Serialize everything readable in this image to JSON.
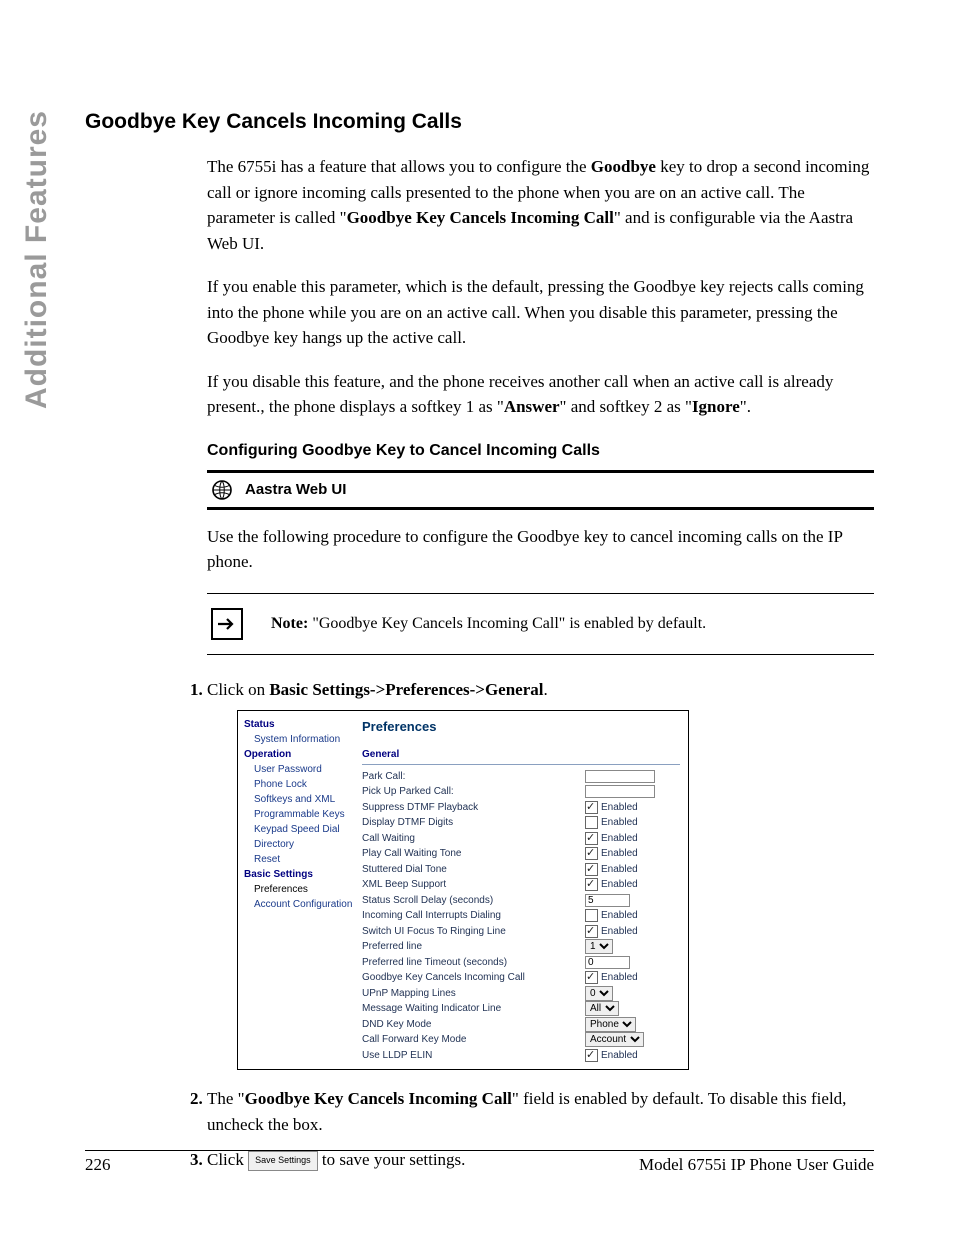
{
  "sideTab": "Additional Features",
  "title": "Goodbye Key Cancels Incoming Calls",
  "para1_a": "The 6755i has a feature that allows you to configure the ",
  "para1_b": "Goodbye",
  "para1_c": " key to drop a second incoming call or ignore incoming calls presented to the phone when you are on an active call. The parameter is called \"",
  "para1_d": "Goodbye Key Cancels Incoming Call",
  "para1_e": "\" and is configurable via the Aastra Web UI.",
  "para2": "If you enable this parameter, which is the default, pressing the Goodbye key rejects calls coming into the phone while you are on an active call. When you disable this parameter, pressing the Goodbye key hangs up the active call.",
  "para3_a": "If you disable this feature, and the phone receives another call when an active call is already present., the phone displays a softkey 1 as \"",
  "para3_b": "Answer",
  "para3_c": "\" and softkey 2 as \"",
  "para3_d": "Ignore",
  "para3_e": "\".",
  "subTitle": "Configuring Goodbye Key to Cancel Incoming Calls",
  "webUiLabel": "Aastra Web UI",
  "para4": "Use the following procedure to configure the Goodbye key to cancel incoming calls on the IP phone.",
  "note_a": "Note:",
  "note_b": " \"Goodbye Key Cancels Incoming Call\" is enabled by default.",
  "step1_a": "Click on ",
  "step1_b": "Basic Settings->Preferences->General",
  "step1_c": ".",
  "step2_a": "The \"",
  "step2_b": "Goodbye Key Cancels Incoming Call",
  "step2_c": "\" field is enabled by default. To disable this field, uncheck the box.",
  "step3_a": "Click ",
  "step3_btn": "Save Settings",
  "step3_b": " to save your settings.",
  "footerPage": "226",
  "footerTitle": "Model 6755i IP Phone User Guide",
  "ui": {
    "nav": {
      "h1": "Status",
      "i1": "System Information",
      "h2": "Operation",
      "i2": "User Password",
      "i3": "Phone Lock",
      "i4": "Softkeys and XML",
      "i5": "Programmable Keys",
      "i6": "Keypad Speed Dial",
      "i7": "Directory",
      "i8": "Reset",
      "h3": "Basic Settings",
      "i9": "Preferences",
      "i10": "Account Configuration"
    },
    "mainTitle": "Preferences",
    "secHdr": "General",
    "rows": {
      "r1": "Park Call:",
      "r2": "Pick Up Parked Call:",
      "r3": "Suppress DTMF Playback",
      "r4": "Display DTMF Digits",
      "r5": "Call Waiting",
      "r6": "Play Call Waiting Tone",
      "r7": "Stuttered Dial Tone",
      "r8": "XML Beep Support",
      "r9": "Status Scroll Delay (seconds)",
      "r10": "Incoming Call Interrupts Dialing",
      "r11": "Switch UI Focus To Ringing Line",
      "r12": "Preferred line",
      "r13": "Preferred line Timeout (seconds)",
      "r14": "Goodbye Key Cancels Incoming Call",
      "r15": "UPnP Mapping Lines",
      "r16": "Message Waiting Indicator Line",
      "r17": "DND Key Mode",
      "r18": "Call Forward Key Mode",
      "r19": "Use LLDP ELIN"
    },
    "enabled": "Enabled",
    "v9": "5",
    "v12": "1",
    "v13": "0",
    "v15": "0",
    "v16": "All",
    "v17": "Phone",
    "v18": "Account"
  }
}
